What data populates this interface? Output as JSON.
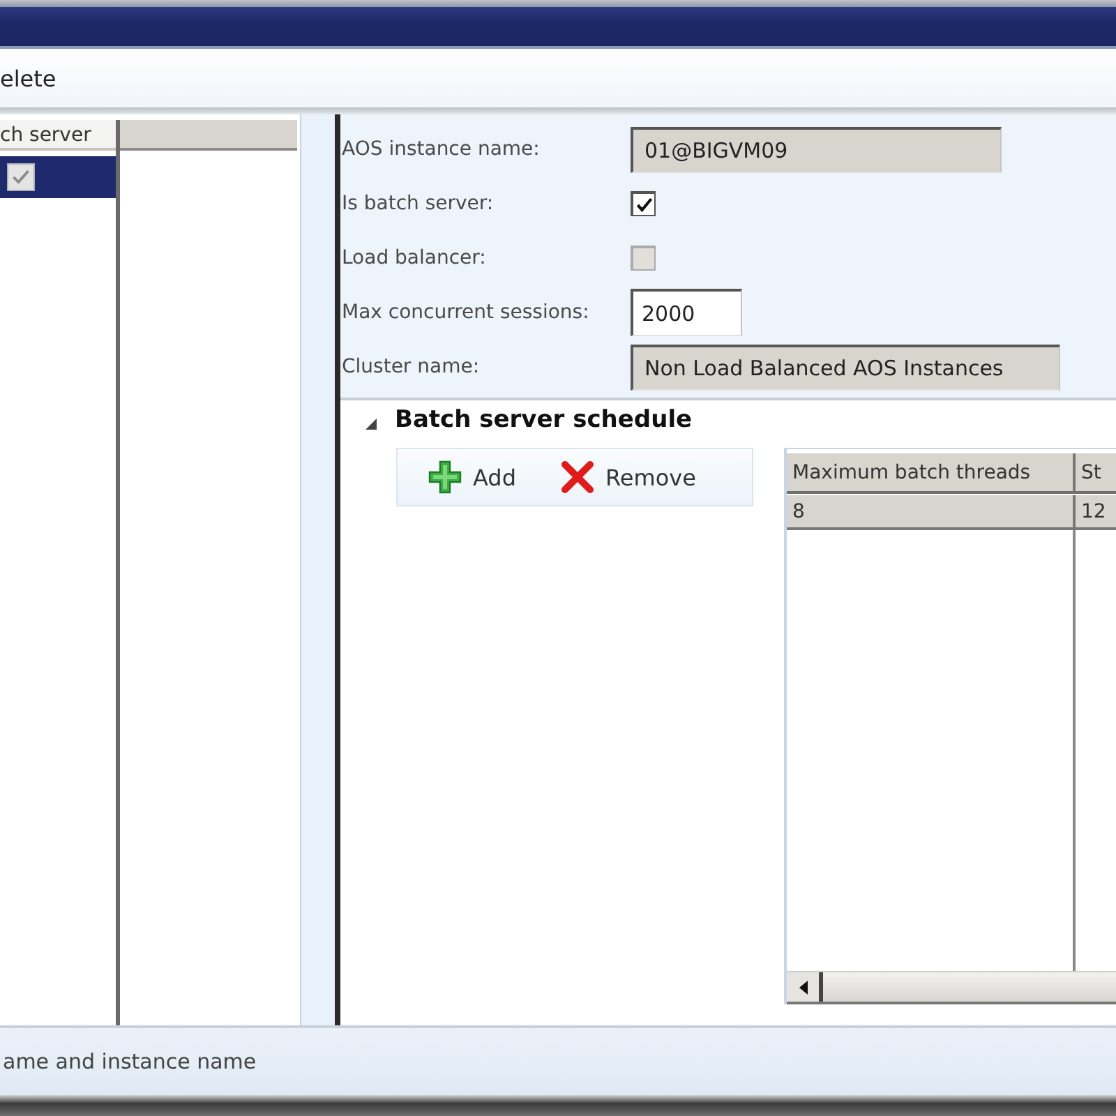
{
  "action_pane": {
    "buttons": [
      {
        "label": "elete"
      }
    ]
  },
  "instances": {
    "columns": [
      "ch server"
    ],
    "rows": [
      {
        "selected": true,
        "checked": true
      }
    ]
  },
  "form": {
    "fields": [
      {
        "kind": "text",
        "label": "AOS instance name:",
        "value": "01@BIGVM09",
        "disabled": true
      },
      {
        "kind": "checkbox",
        "label": "Is batch server:",
        "checked": true,
        "disabled": false
      },
      {
        "kind": "checkbox",
        "label": "Load balancer:",
        "checked": false,
        "disabled": true
      },
      {
        "kind": "number",
        "label": "Max concurrent sessions:",
        "value": "2000",
        "disabled": false
      },
      {
        "kind": "text",
        "label": "Cluster name:",
        "value": "Non Load Balanced AOS Instances",
        "disabled": true
      }
    ]
  },
  "schedule": {
    "title": "Batch server schedule",
    "expanded": true,
    "toolbar": [
      {
        "kind": "add",
        "label": "Add"
      },
      {
        "kind": "remove",
        "label": "Remove"
      }
    ],
    "grid": {
      "columns": [
        "Maximum batch threads",
        "St"
      ],
      "rows": [
        {
          "selected": true,
          "cells": [
            "8",
            "12"
          ]
        }
      ]
    }
  },
  "status_bar": {
    "text": "ame and instance name"
  }
}
